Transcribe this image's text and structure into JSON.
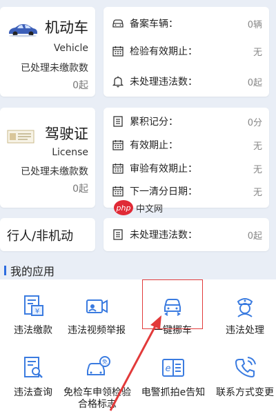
{
  "vehicle_card": {
    "title": "机动车",
    "subtitle": "Vehicle",
    "status": "已处理未缴款数",
    "count": "0起"
  },
  "license_card": {
    "title": "驾驶证",
    "subtitle": "License",
    "status": "已处理未缴款数",
    "count": "0起"
  },
  "pedestrian_card": {
    "title": "行人/非机动"
  },
  "vehicle_info": [
    {
      "label": "备案车辆：",
      "value": "0辆",
      "icon": "car-icon"
    },
    {
      "label": "检验有效期止：",
      "value": "无",
      "icon": "calendar-icon"
    },
    {
      "label": "未处理违法数：",
      "value": "0起",
      "icon": "bell-icon"
    }
  ],
  "license_info": [
    {
      "label": "累积记分：",
      "value": "0分",
      "icon": "document-icon"
    },
    {
      "label": "有效期止：",
      "value": "无",
      "icon": "calendar-icon"
    },
    {
      "label": "审验有效期止：",
      "value": "无",
      "icon": "calendar-icon"
    },
    {
      "label": "下一清分日期：",
      "value": "无",
      "icon": "calendar-icon"
    }
  ],
  "pedestrian_info": [
    {
      "label": "未处理违法数：",
      "value": "0起",
      "icon": "document-icon"
    }
  ],
  "section": {
    "title": "我的应用"
  },
  "apps": [
    {
      "label": "违法缴款",
      "icon": "payment-icon"
    },
    {
      "label": "违法视频举报",
      "icon": "video-report-icon"
    },
    {
      "label": "一键挪车",
      "icon": "move-car-icon"
    },
    {
      "label": "违法处理",
      "icon": "police-icon"
    },
    {
      "label": "违法查询",
      "icon": "search-document-icon"
    },
    {
      "label": "免检车申领检验合格标志",
      "icon": "exempt-car-icon"
    },
    {
      "label": "电警抓拍e告知",
      "icon": "e-notice-icon"
    },
    {
      "label": "联系方式变更",
      "icon": "phone-icon"
    }
  ],
  "watermark": {
    "logo": "php",
    "text": "中文网"
  },
  "colors": {
    "accent": "#2d6cdf",
    "highlight": "#e23a3a",
    "background": "#e9eef6"
  }
}
